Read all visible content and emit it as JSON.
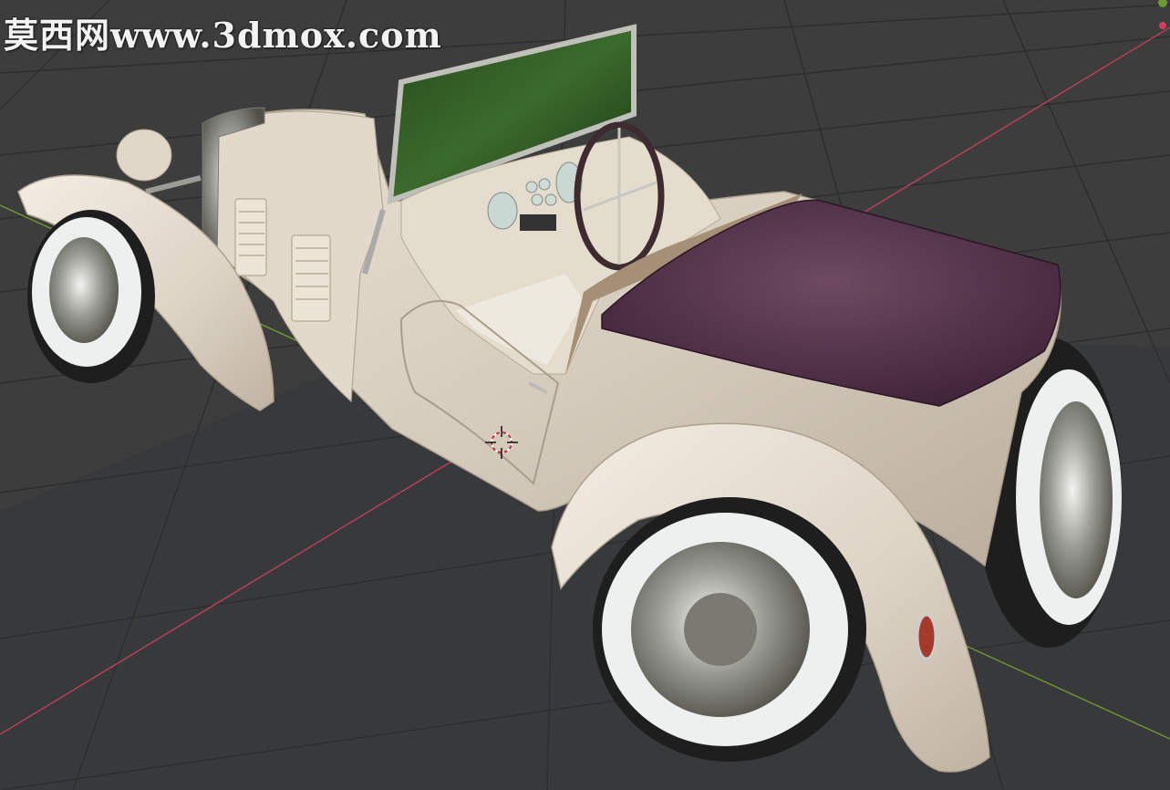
{
  "viewport": {
    "watermark": "莫西网www.3dmox.com",
    "scene_object": "vintage roadster car model",
    "colors": {
      "background": "#3d3d3d",
      "grid_line": "#2e2e2e",
      "x_axis": "#b0405a",
      "y_axis": "#6f9a2e",
      "car_body": "#d9cfc1",
      "seat_cover": "#4a2a45",
      "tire": "#222222",
      "whitewall": "#eef0f0"
    }
  }
}
